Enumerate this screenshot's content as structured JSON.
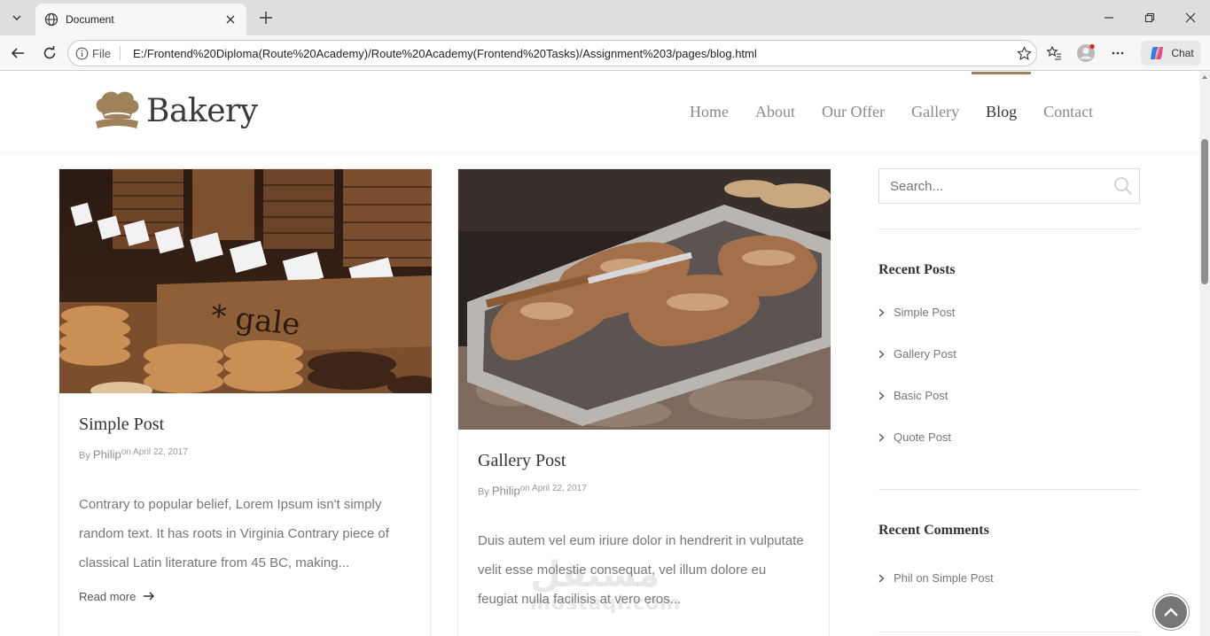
{
  "browser": {
    "tab_title": "Document",
    "address_prefix": "File",
    "url": "E:/Frontend%20Diploma(Route%20Academy)/Route%20Academy(Frontend%20Tasks)/Assignment%203/pages/blog.html",
    "chat_label": "Chat"
  },
  "site": {
    "logo_text": "Bakery",
    "accent_color": "#a0825a",
    "nav": [
      {
        "label": "Home"
      },
      {
        "label": "About"
      },
      {
        "label": "Our Offer"
      },
      {
        "label": "Gallery"
      },
      {
        "label": "Blog",
        "active": true
      },
      {
        "label": "Contact"
      }
    ]
  },
  "posts": [
    {
      "title": "Simple Post",
      "by": "By",
      "author": "Philip",
      "date": "on April 22, 2017",
      "excerpt": "Contrary to popular belief, Lorem Ipsum isn't simply random text. It has roots in Virginia Contrary piece of classical Latin literature from 45 BC, making...",
      "read_more": "Read more"
    },
    {
      "title": "Gallery Post",
      "by": "By",
      "author": "Philip",
      "date": "on April 22, 2017",
      "excerpt": "Duis autem vel eum iriure dolor in hendrerit in vulputate velit esse molestie consequat, vel illum dolore eu feugiat nulla facilisis at vero eros..."
    }
  ],
  "sidebar": {
    "search_placeholder": "Search...",
    "recent_posts_title": "Recent Posts",
    "recent_posts": [
      "Simple Post",
      "Gallery Post",
      "Basic Post",
      "Quote Post"
    ],
    "recent_comments_title": "Recent Comments",
    "comment": {
      "author": "Phil",
      "on": "on",
      "post": "Simple Post"
    }
  }
}
